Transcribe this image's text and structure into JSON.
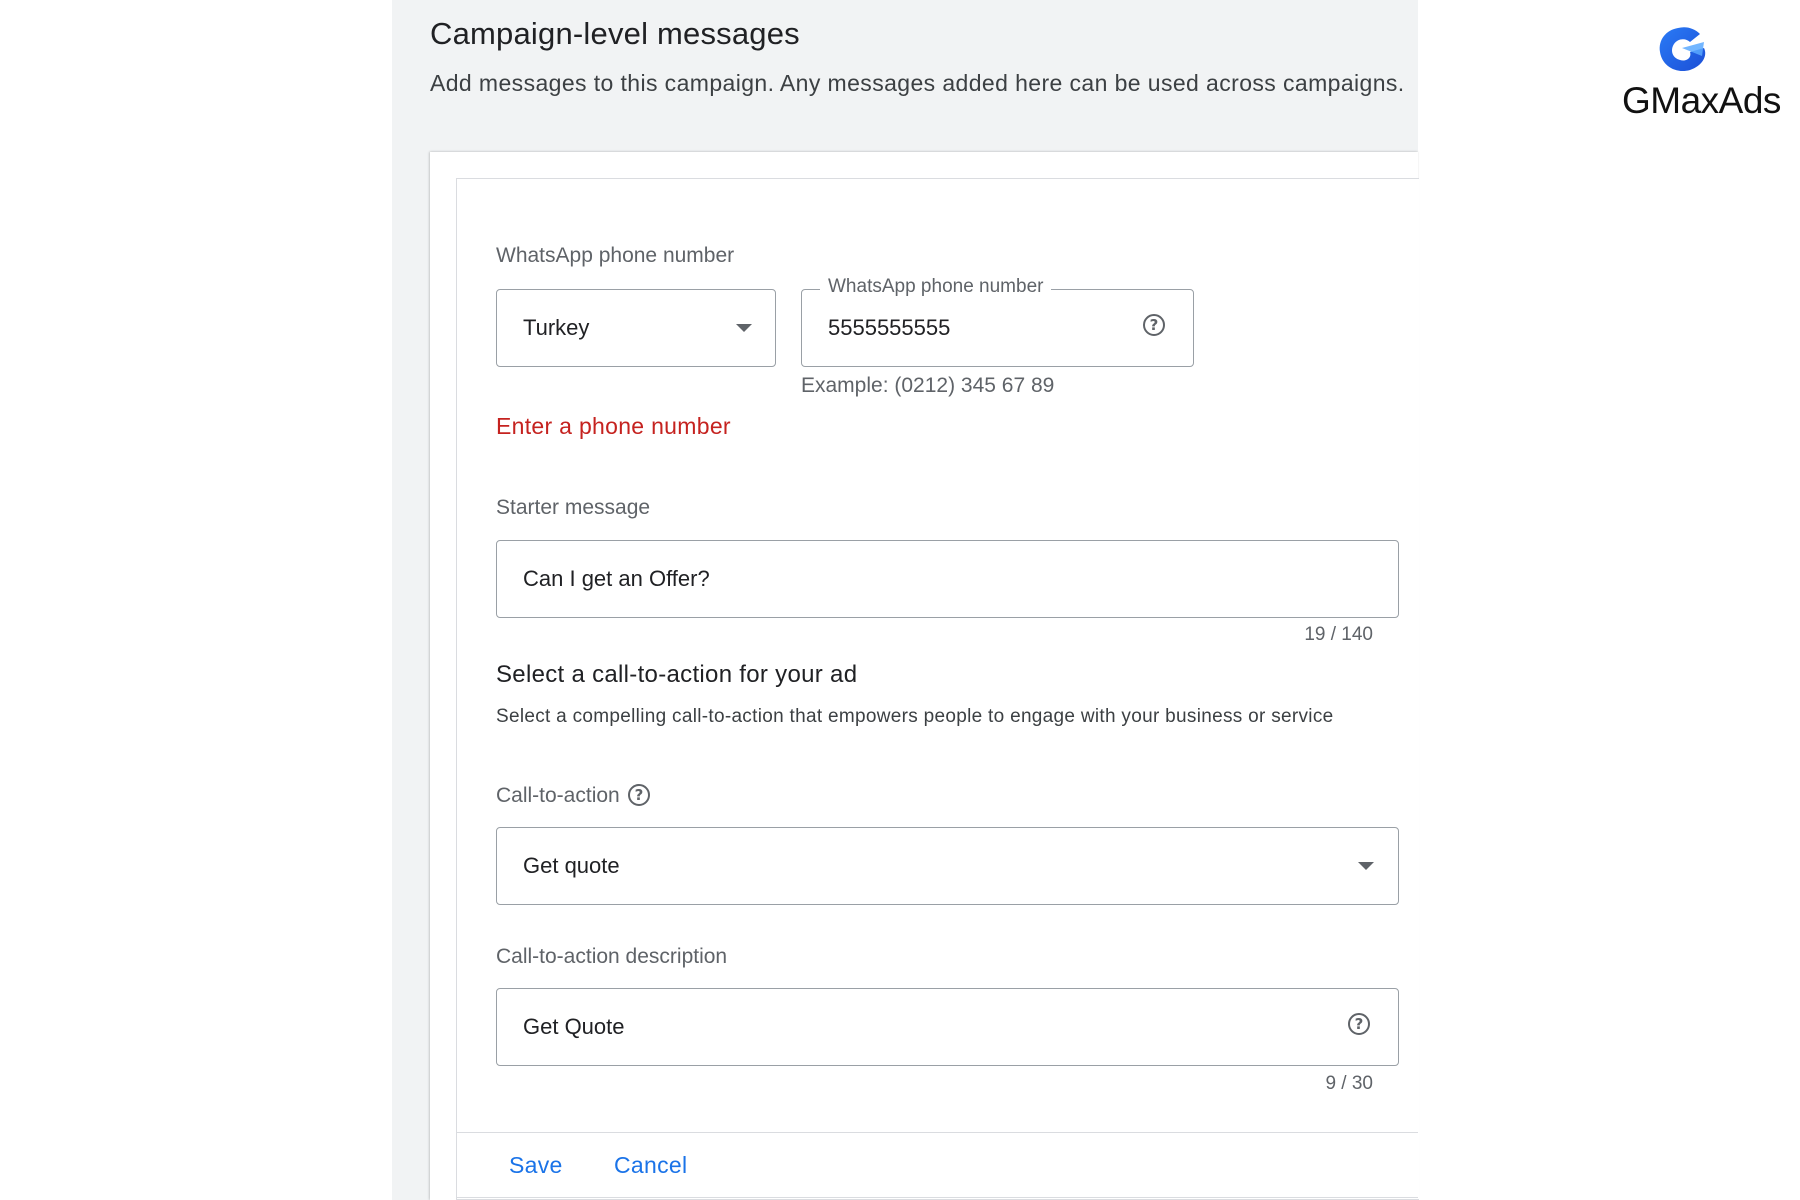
{
  "header": {
    "title": "Campaign-level messages",
    "subtitle": "Add messages to this campaign. Any messages added here can be used across campaigns."
  },
  "whatsapp": {
    "section_label": "WhatsApp phone number",
    "country_value": "Turkey",
    "phone_floating_label": "WhatsApp phone number",
    "phone_value": "5555555555",
    "phone_hint": "Example: (0212) 345 67 89",
    "error": "Enter a phone number"
  },
  "starter": {
    "label": "Starter message",
    "value": "Can I get an Offer?",
    "counter": "19 / 140"
  },
  "cta_section": {
    "title": "Select a call-to-action for your ad",
    "description": "Select a compelling call-to-action that empowers people to engage with your business or service",
    "cta_label": "Call-to-action",
    "cta_value": "Get quote",
    "cta_desc_label": "Call-to-action description",
    "cta_desc_value": "Get Quote",
    "cta_desc_counter": "9 / 30"
  },
  "footer": {
    "save_label": "Save",
    "cancel_label": "Cancel"
  },
  "logo": {
    "text": "GMaxAds",
    "icon": "gmaxads-logo-icon"
  },
  "colors": {
    "accent": "#1a73e8",
    "error": "#c5221f",
    "panel_bg": "#f1f3f4"
  }
}
